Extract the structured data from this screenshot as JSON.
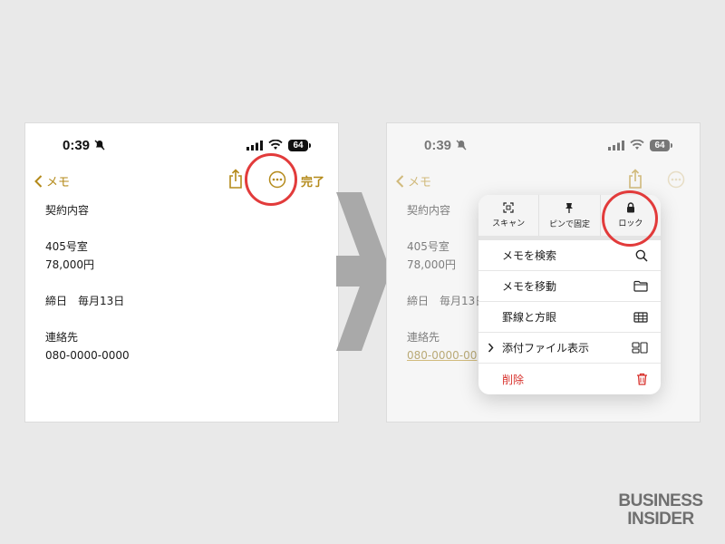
{
  "status": {
    "time": "0:39",
    "battery": "64"
  },
  "nav": {
    "back_label": "メモ",
    "done_label": "完了"
  },
  "note": {
    "title": "契約内容",
    "room": "405号室",
    "price": "78,000円",
    "deadline": "締日　毎月13日",
    "contact_label": "連絡先",
    "phone": "080-0000-0000",
    "phone_truncated": "080-0000-00"
  },
  "menu": {
    "quick_actions": [
      {
        "label": "スキャン",
        "icon": "scan-icon"
      },
      {
        "label": "ピンで固定",
        "icon": "pin-icon"
      },
      {
        "label": "ロック",
        "icon": "lock-icon"
      }
    ],
    "items": [
      {
        "label": "メモを検索",
        "icon": "search-icon"
      },
      {
        "label": "メモを移動",
        "icon": "folder-icon"
      },
      {
        "label": "罫線と方眼",
        "icon": "grid-icon"
      },
      {
        "label": "添付ファイル表示",
        "icon": "attachments-icon"
      },
      {
        "label": "削除",
        "icon": "trash-icon"
      }
    ]
  },
  "colors": {
    "accent": "#b48a1a",
    "highlight": "#e23b3b",
    "danger": "#d8312c",
    "background": "#e9e9e9"
  },
  "watermark": {
    "line1": "BUSINESS",
    "line2": "INSIDER"
  }
}
